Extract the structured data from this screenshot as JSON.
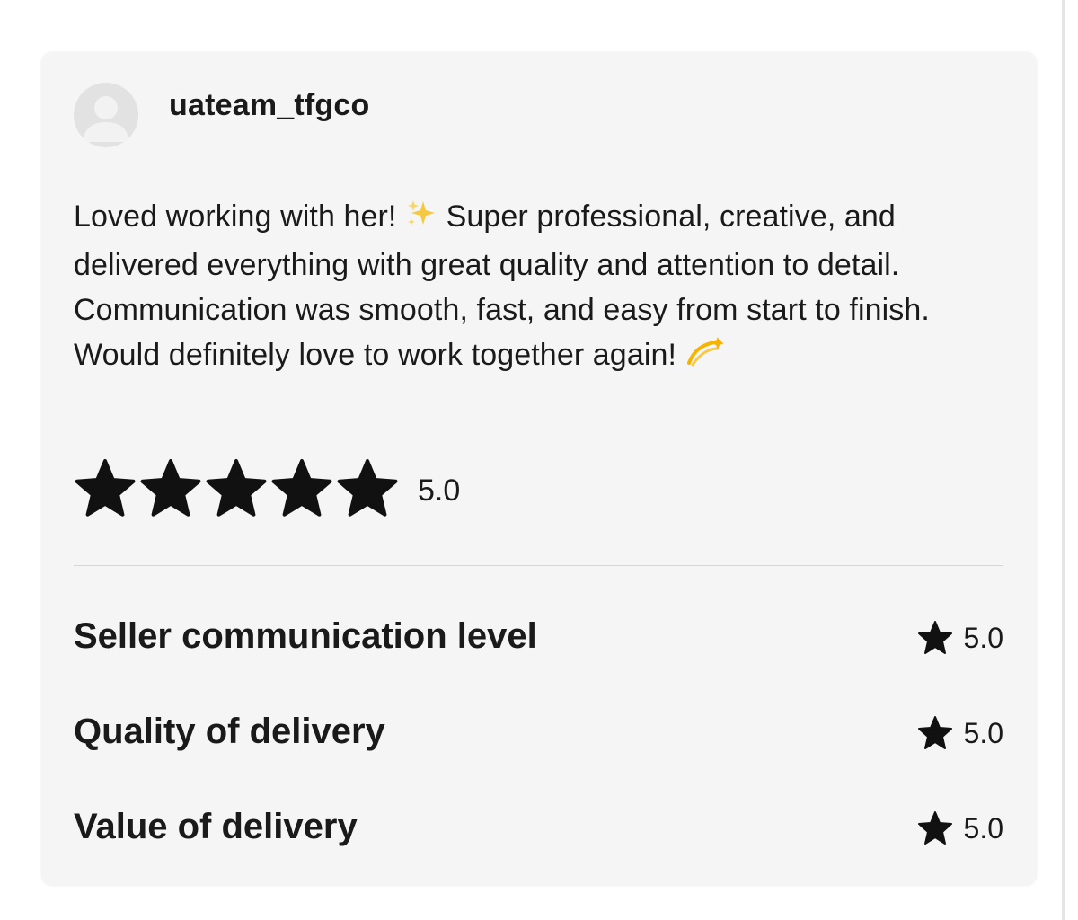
{
  "review": {
    "username": "uateam_tfgco",
    "text_parts": [
      "Loved working with her! ",
      " Super professional, creative, and delivered everything with great quality and attention to detail. Communication was smooth, fast, and easy from start to finish. Would definitely love to work together again! "
    ],
    "emoji_1": "sparkles-icon",
    "emoji_2": "dizzy-icon",
    "overall_rating": 5.0,
    "overall_rating_text": "5.0",
    "star_count": 5
  },
  "breakdown": [
    {
      "label": "Seller communication level",
      "value": "5.0"
    },
    {
      "label": "Quality of delivery",
      "value": "5.0"
    },
    {
      "label": "Value of delivery",
      "value": "5.0"
    }
  ],
  "colors": {
    "card_background": "#f5f5f5",
    "star": "#111111",
    "text": "#1a1a1a",
    "divider": "#d6d6d6",
    "avatar_background": "#e2e2e2",
    "avatar_figure": "#f2f2f2",
    "sparkle": "#f5c842",
    "dizzy": "#f4b400"
  }
}
